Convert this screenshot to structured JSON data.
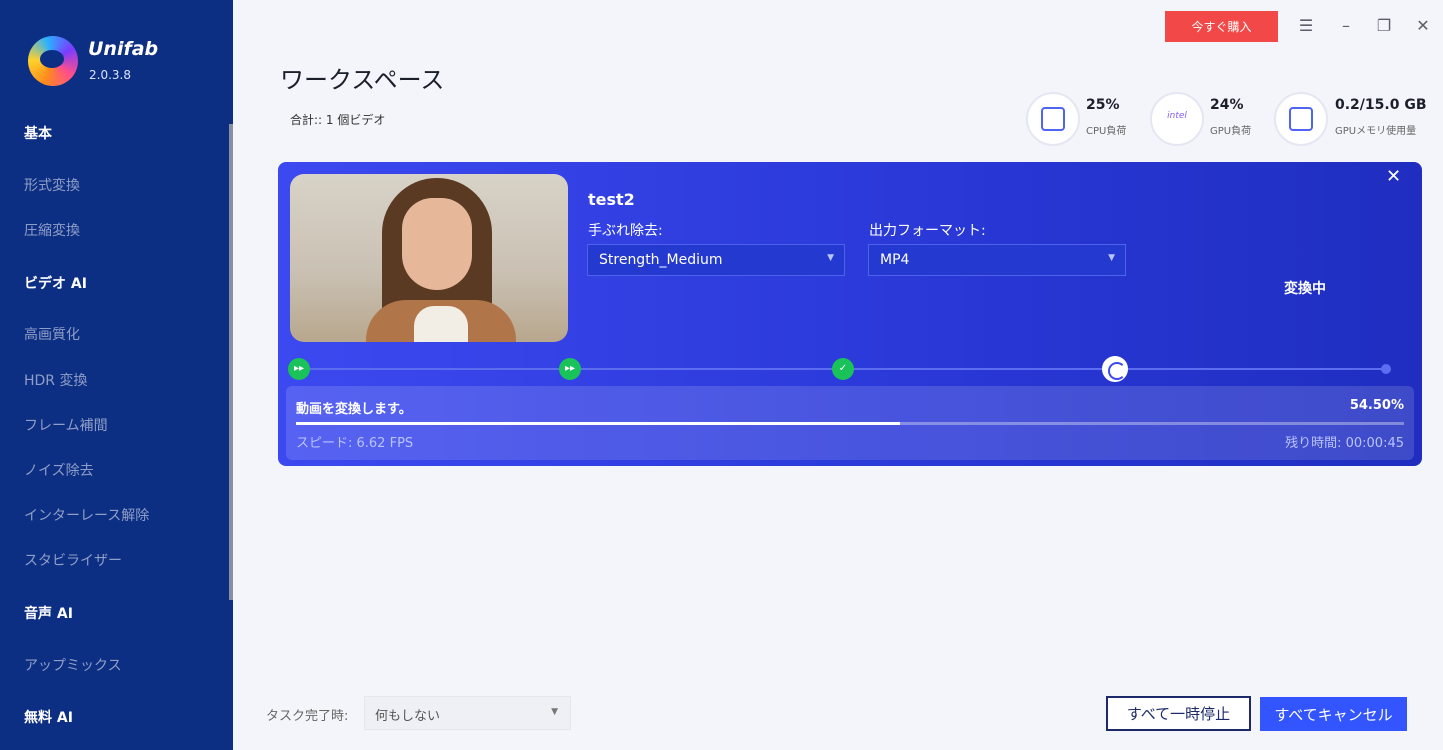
{
  "app": {
    "name": "Unifab",
    "version": "2.0.3.8"
  },
  "sidebar": {
    "items": [
      {
        "label": "基本",
        "section": true
      },
      {
        "label": "形式変換",
        "section": false
      },
      {
        "label": "圧縮変換",
        "section": false
      },
      {
        "label": "ビデオ AI",
        "section": true
      },
      {
        "label": "高画質化",
        "section": false
      },
      {
        "label": "HDR 変換",
        "section": false
      },
      {
        "label": "フレーム補間",
        "section": false
      },
      {
        "label": "ノイズ除去",
        "section": false
      },
      {
        "label": "インターレース解除",
        "section": false
      },
      {
        "label": "スタビライザー",
        "section": false
      },
      {
        "label": "音声 AI",
        "section": true
      },
      {
        "label": "アップミックス",
        "section": false
      },
      {
        "label": "無料 AI",
        "section": true
      }
    ]
  },
  "header": {
    "buy_label": "今すぐ購入",
    "menu_icon": "menu-icon",
    "minimize_icon": "minimize-icon",
    "restore_icon": "restore-icon",
    "close_icon": "close-icon"
  },
  "workspace": {
    "title": "ワークスペース",
    "total": "合計:: 1 個ビデオ"
  },
  "stats": {
    "cpu": {
      "value": "25%",
      "label": "CPU負荷",
      "icon": "cpu-icon"
    },
    "gpu": {
      "value": "24%",
      "label": "GPU負荷",
      "icon": "intel-icon",
      "icon_text": "intel"
    },
    "gpu_mem": {
      "value": "0.2/15.0 GB",
      "label": "GPUメモリ使用量",
      "icon": "memory-icon"
    }
  },
  "task": {
    "name": "test2",
    "deshake_label": "手ぶれ除去:",
    "deshake_value": "Strength_Medium",
    "format_label": "出力フォーマット:",
    "format_value": "MP4",
    "state": "変換中",
    "progress_title": "動画を変換します。",
    "progress_percent": "54.50%",
    "progress_value": 0.545,
    "speed": "スピード: 6.62  FPS",
    "remaining": "残り時間: 00:00:45"
  },
  "footer": {
    "on_complete_label": "タスク完了時:",
    "on_complete_value": "何もしない",
    "pause_all": "すべて一時停止",
    "cancel_all": "すべてキャンセル"
  },
  "colors": {
    "sidebar_bg": "#0d2f83",
    "card_accent": "#2a39d8",
    "buy_red": "#f24848",
    "cancel_blue": "#3355ff",
    "done_green": "#19c35a"
  }
}
